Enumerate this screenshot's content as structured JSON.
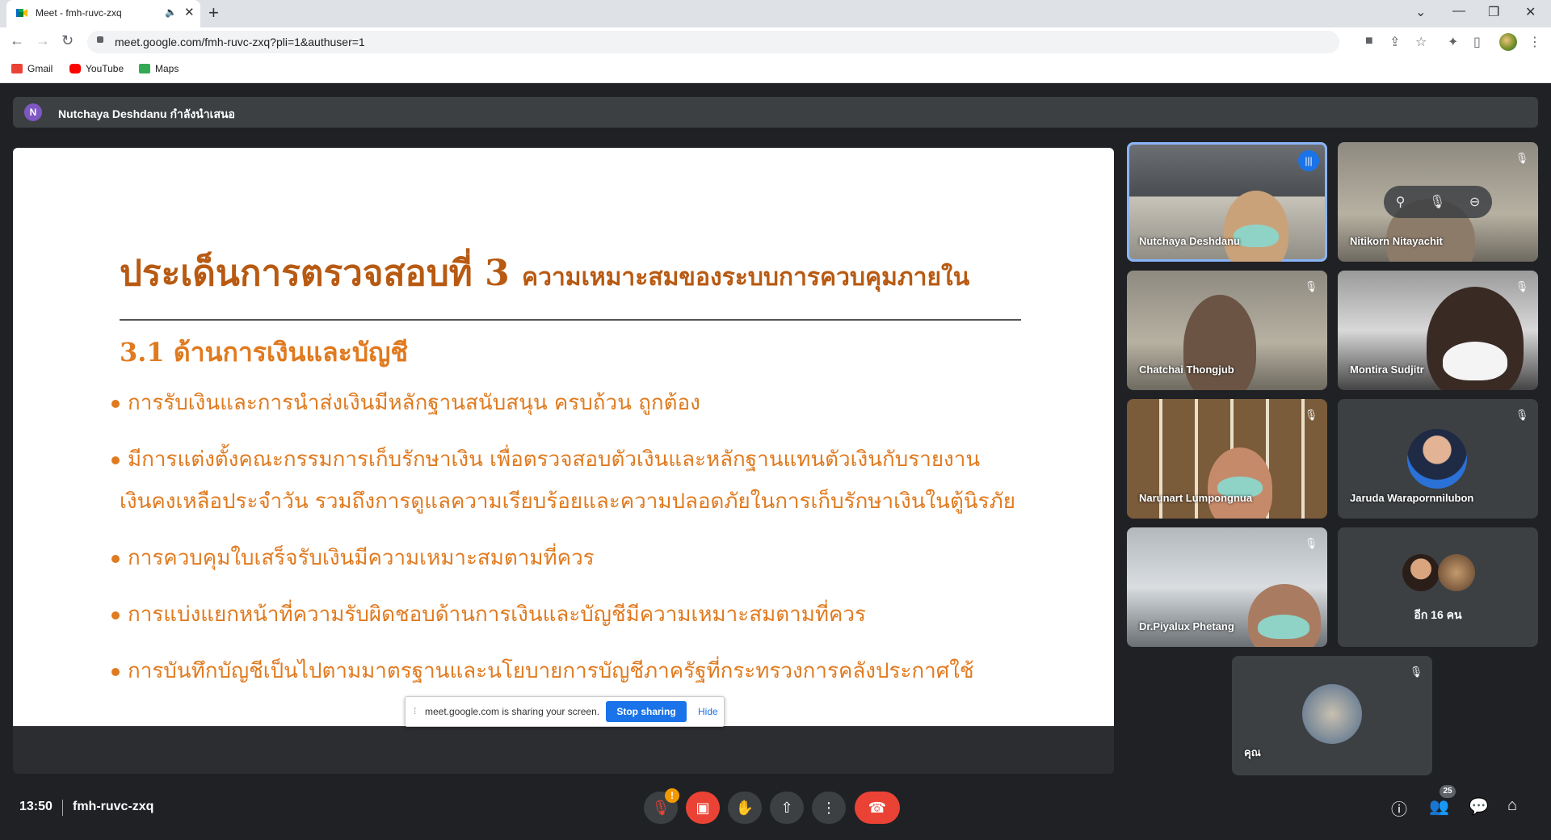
{
  "browser": {
    "tab_title": "Meet - fmh-ruvc-zxq",
    "url": "meet.google.com/fmh-ruvc-zxq?pli=1&authuser=1",
    "bookmarks": [
      {
        "label": "Gmail",
        "icon": "gmail-icon",
        "color": "#ea4335"
      },
      {
        "label": "YouTube",
        "icon": "youtube-icon",
        "color": "#ff0000"
      },
      {
        "label": "Maps",
        "icon": "maps-icon",
        "color": "#34a853"
      }
    ]
  },
  "meet": {
    "presenter_initial": "N",
    "presenter_text": "Nutchaya Deshdanu กำลังนำเสนอ",
    "slide": {
      "title_main": "ประเด็นการตรวจสอบที่ 3",
      "title_sub": "ความเหมาะสมของระบบการควบคุมภายใน",
      "section": "3.1 ด้านการเงินและบัญชี",
      "bullets": [
        "การรับเงินและการนำส่งเงินมีหลักฐานสนับสนุน ครบถ้วน ถูกต้อง",
        "มีการแต่งตั้งคณะกรรมการเก็บรักษาเงิน เพื่อตรวจสอบตัวเงินและหลักฐานแทนตัวเงินกับรายงาน",
        "เงินคงเหลือประจำวัน รวมถึงการดูแลความเรียบร้อยและความปลอดภัยในการเก็บรักษาเงินในตู้นิรภัย",
        "การควบคุมใบเสร็จรับเงินมีความเหมาะสมตามที่ควร",
        "การแบ่งแยกหน้าที่ความรับผิดชอบด้านการเงินและบัญชีมีความเหมาะสมตามที่ควร",
        "การบันทึกบัญชีเป็นไปตามมาตรฐานและนโยบายการบัญชีภาครัฐที่กระทรวงการคลังประกาศใช้"
      ]
    },
    "share_banner": {
      "message": "meet.google.com is sharing your screen.",
      "stop_label": "Stop sharing",
      "hide_label": "Hide"
    },
    "participants": [
      {
        "name": "Nutchaya Deshdanu"
      },
      {
        "name": "Nitikorn Nitayachit"
      },
      {
        "name": "Chatchai Thongjub"
      },
      {
        "name": "Montira Sudjitr"
      },
      {
        "name": "Narunart Lumpongnua"
      },
      {
        "name": "Jaruda Waraporn­nilubon"
      },
      {
        "name": "Dr.Piyalux Phetang"
      },
      {
        "name": "อีก 16 คน"
      },
      {
        "name": "คุณ"
      }
    ],
    "time": "13:50",
    "meeting_code": "fmh-ruvc-zxq",
    "participant_count": "25",
    "accent_color": "#1a73e8",
    "danger_color": "#ea4335"
  }
}
